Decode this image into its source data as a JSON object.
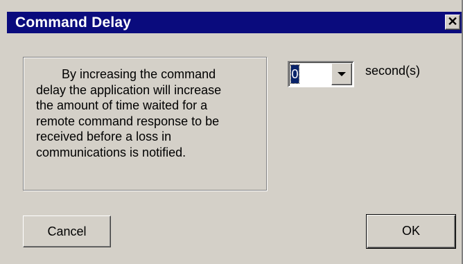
{
  "window": {
    "title": "Command Delay",
    "close_glyph": "✕"
  },
  "info": {
    "lines": [
      "By increasing the command",
      "delay the application will increase",
      "the amount of time waited for a",
      "remote command response to be",
      "received before a loss in",
      "communications is notified."
    ]
  },
  "delay_select": {
    "value": "0",
    "unit": "second(s)"
  },
  "buttons": {
    "cancel": "Cancel",
    "ok": "OK"
  },
  "colors": {
    "titlebar": "#0a0b7d",
    "face": "#d4d0c8",
    "selection": "#0a246a"
  }
}
